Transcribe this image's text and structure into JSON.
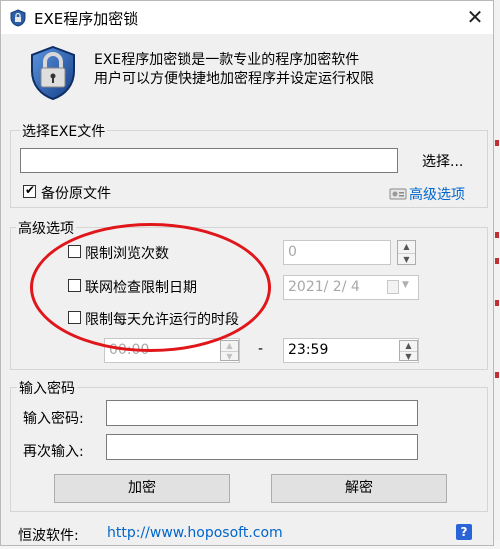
{
  "window": {
    "title": "EXE程序加密锁",
    "close_glyph": "✕"
  },
  "header": {
    "line1": "EXE程序加密锁是一款专业的程序加密软件",
    "line2": "用户可以方便快捷地加密程序并设定运行权限"
  },
  "select_group": {
    "title": "选择EXE文件",
    "file_value": "",
    "browse_label": "选择...",
    "backup_label": "备份原文件",
    "backup_checked": true,
    "advanced_link": "高级选项"
  },
  "advanced": {
    "title": "高级选项",
    "limit_views_label": "限制浏览次数",
    "views_value": "0",
    "online_date_label": "联网检查限制日期",
    "date_value": "2021/  2/  4",
    "limit_period_label": "限制每天允许运行的时段",
    "start_time": "00:00",
    "separator": "-",
    "end_time": "23:59"
  },
  "password": {
    "title": "输入密码",
    "input_label": "输入密码:",
    "input_value": "",
    "confirm_label": "再次输入:",
    "confirm_value": "",
    "encrypt_label": "加密",
    "decrypt_label": "解密"
  },
  "footer": {
    "company": "恒波软件:",
    "url": "http://www.hoposoft.com",
    "help_glyph": "?"
  },
  "colors": {
    "annotation": "#e0161b",
    "link": "#0066cc",
    "window_bg": "#f0f0f0"
  }
}
